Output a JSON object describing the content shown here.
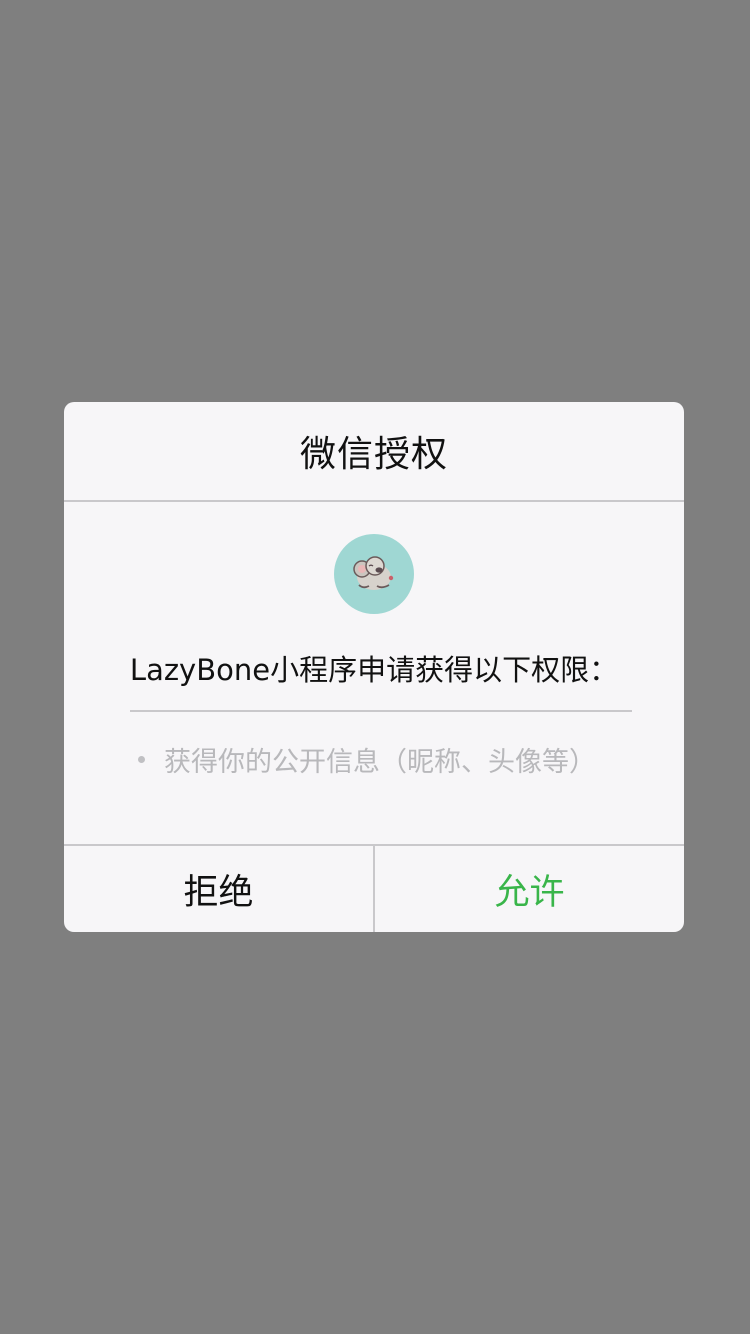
{
  "dialog": {
    "title": "微信授权",
    "avatar_icon": "koala-avatar-icon",
    "request_text": "LazyBone小程序申请获得以下权限：",
    "permissions": [
      "获得你的公开信息（昵称、头像等）"
    ],
    "deny_label": "拒绝",
    "allow_label": "允许"
  },
  "colors": {
    "overlay": "#7f7f7f",
    "dialog_bg": "#f7f6f8",
    "allow": "#39b54a",
    "avatar_bg": "#9fd7d3"
  }
}
